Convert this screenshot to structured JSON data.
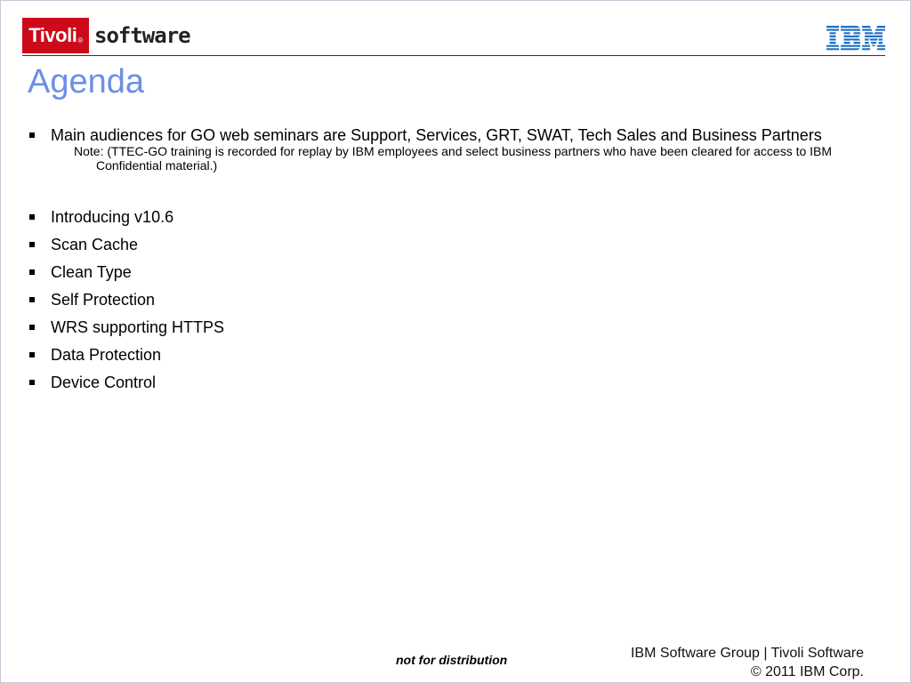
{
  "header": {
    "brand_name": "Tivoli",
    "brand_mark": "®",
    "product_word": "software",
    "company_logo": "IBM"
  },
  "title": "Agenda",
  "agenda": {
    "first_item": "Main audiences for GO web seminars are Support, Services, GRT, SWAT, Tech Sales and Business Partners",
    "note": "Note: (TTEC-GO training is recorded for replay by IBM employees and select business partners who have been cleared for access to IBM Confidential material.)",
    "items": [
      "Introducing v10.6",
      "Scan Cache",
      "Clean Type",
      "Self Protection",
      "WRS supporting HTTPS",
      "Data Protection",
      "Device Control"
    ]
  },
  "footer": {
    "distribution_note": "not for distribution",
    "group_line": "IBM Software Group | Tivoli Software",
    "copyright_line": "© 2011 IBM Corp."
  },
  "colors": {
    "title": "#6c8ee8",
    "tivoli_red": "#cc0a1a",
    "ibm_blue": "#1f70c1"
  }
}
